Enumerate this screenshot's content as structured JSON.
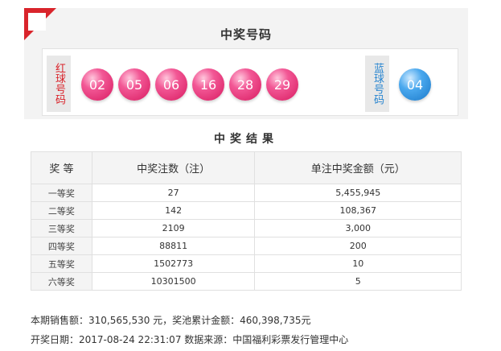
{
  "panel": {
    "title": "中奖号码",
    "red_label": "红球号码",
    "blue_label": "蓝球号码",
    "red_balls": [
      "02",
      "05",
      "06",
      "16",
      "28",
      "29"
    ],
    "blue_ball": "04"
  },
  "results": {
    "title": "中奖结果",
    "headers": [
      "奖 等",
      "中奖注数（注）",
      "单注中奖金额（元）"
    ],
    "rows": [
      {
        "level": "一等奖",
        "count": "27",
        "amount": "5,455,945"
      },
      {
        "level": "二等奖",
        "count": "142",
        "amount": "108,367"
      },
      {
        "level": "三等奖",
        "count": "2109",
        "amount": "3,000"
      },
      {
        "level": "四等奖",
        "count": "88811",
        "amount": "200"
      },
      {
        "level": "五等奖",
        "count": "1502773",
        "amount": "10"
      },
      {
        "level": "六等奖",
        "count": "10301500",
        "amount": "5"
      }
    ]
  },
  "footer": {
    "line1": "本期销售额：310,565,530 元，奖池累计金额：460,398,735元",
    "line2": "开奖日期：2017-08-24 22:31:07 数据来源：中国福利彩票发行管理中心"
  },
  "colors": {
    "accent_red": "#d9242b",
    "ball_red": "#e91e63",
    "ball_blue": "#2a86d0",
    "blue_label": "#2a86d0"
  }
}
